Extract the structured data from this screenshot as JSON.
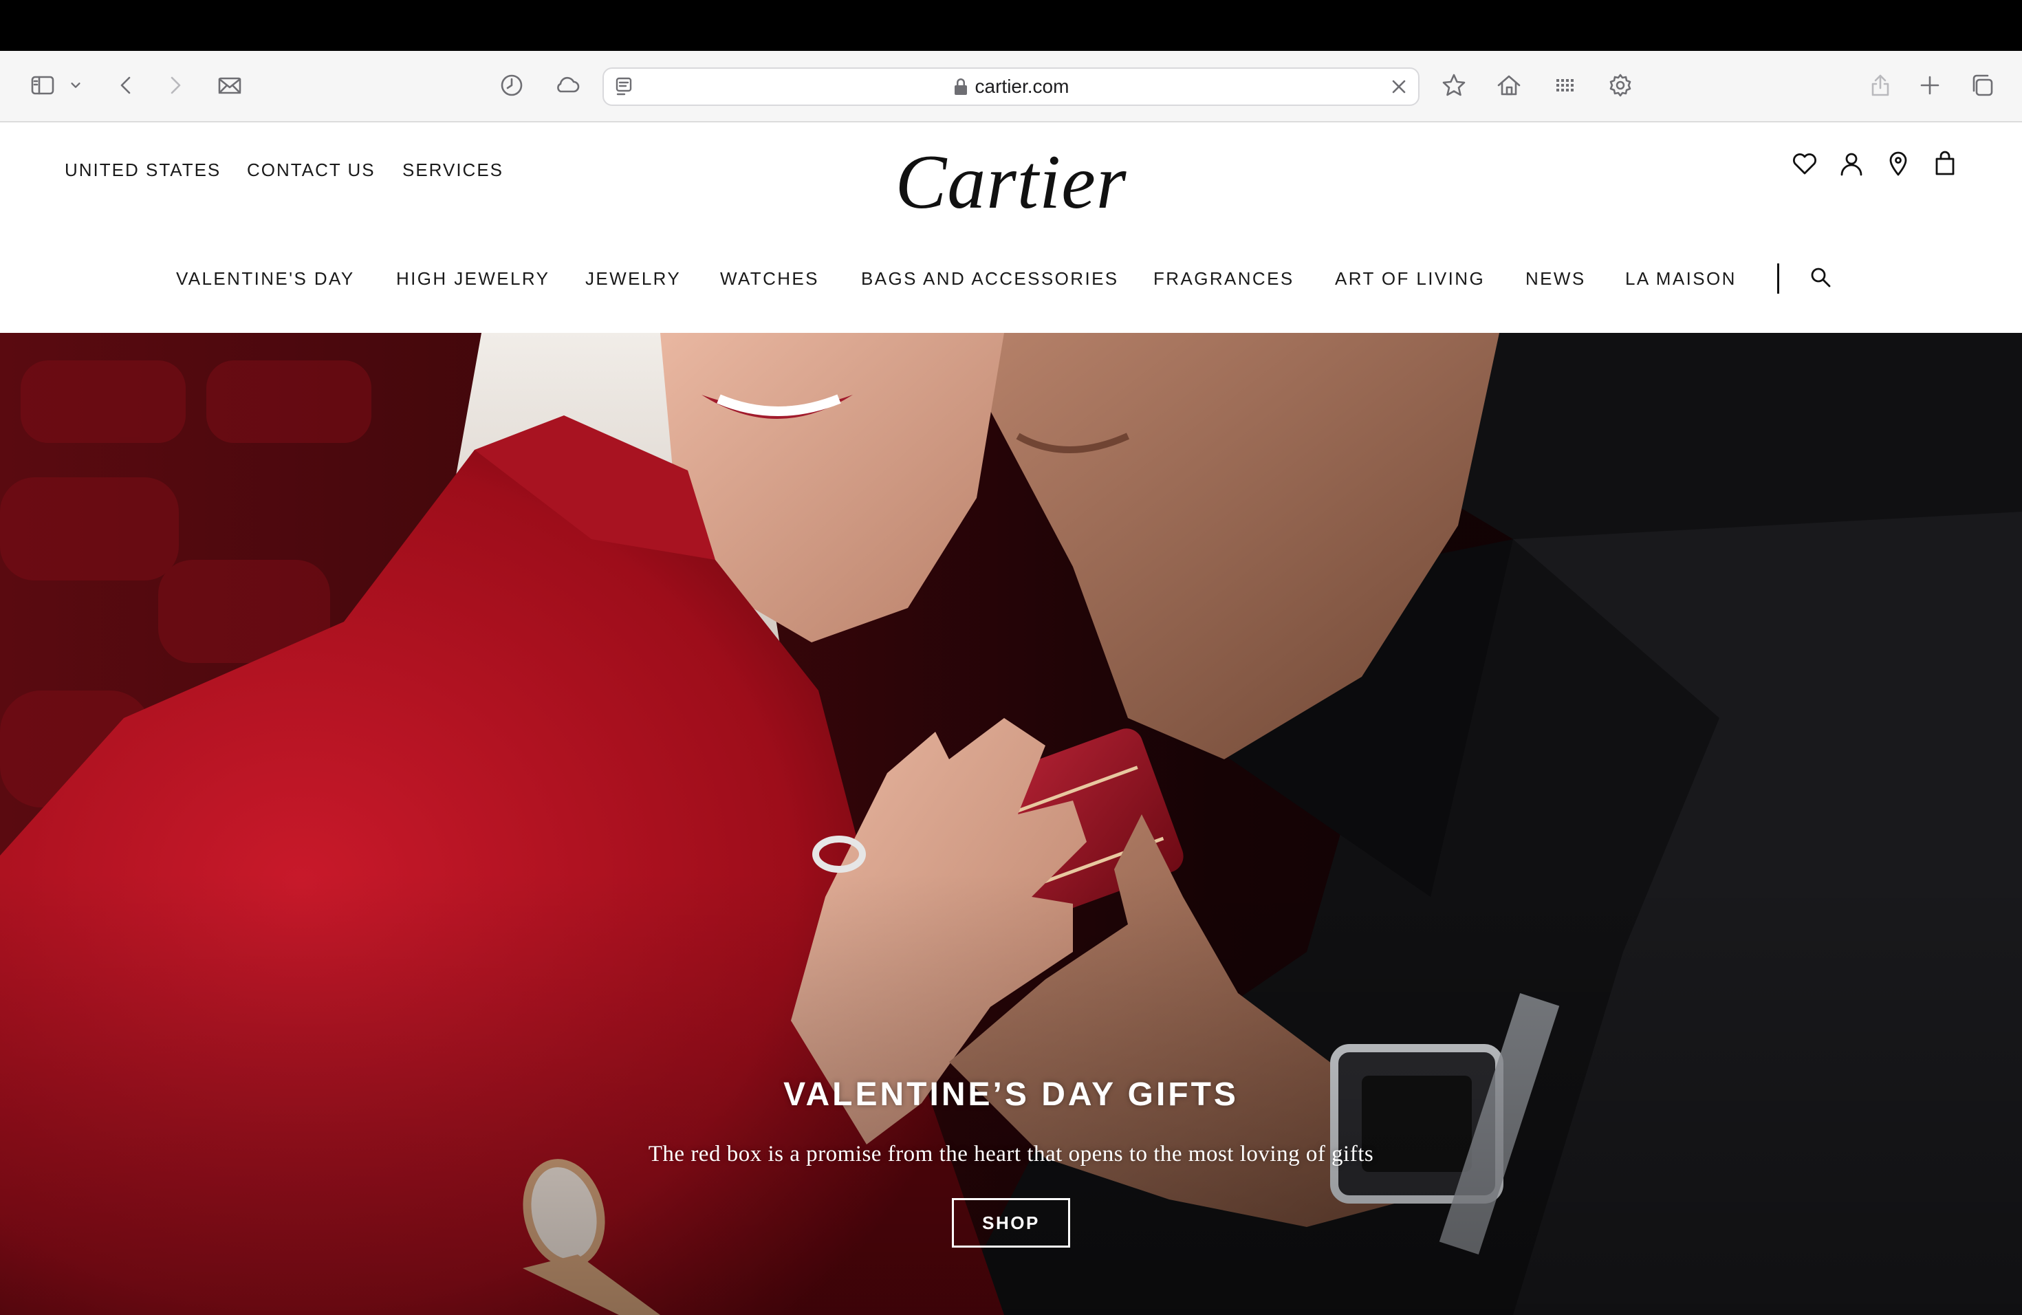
{
  "browser": {
    "url": "cartier.com"
  },
  "header": {
    "utility_links": [
      "UNITED STATES",
      "CONTACT US",
      "SERVICES"
    ],
    "logo": "Cartier"
  },
  "nav": {
    "items": [
      "VALENTINE'S DAY",
      "HIGH JEWELRY",
      "JEWELRY",
      "WATCHES",
      "BAGS AND ACCESSORIES",
      "FRAGRANCES",
      "ART OF LIVING",
      "NEWS",
      "LA MAISON"
    ]
  },
  "hero": {
    "title": "VALENTINE’S DAY GIFTS",
    "subtitle": "The red box is a promise from the heart that opens to the most loving of gifts",
    "cta": "SHOP"
  },
  "colors": {
    "brand_red": "#b5121b",
    "text": "#1a1a1a"
  }
}
